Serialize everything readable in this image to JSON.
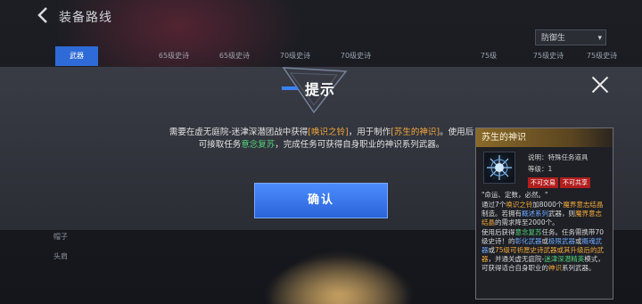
{
  "header": {
    "title": "装备路线"
  },
  "filter": {
    "selected": "防御生"
  },
  "tabs": [
    {
      "label": "武器",
      "active": true
    },
    {
      "label": "65级史诗"
    },
    {
      "label": "65级史诗"
    },
    {
      "label": "70级史诗"
    },
    {
      "label": "70级史诗"
    },
    {
      "label": "75级"
    },
    {
      "label": "75级史诗"
    },
    {
      "label": "75级史诗"
    }
  ],
  "bg_list": [
    "帽子",
    "头肩"
  ],
  "dialog": {
    "title": "提示",
    "message_parts": {
      "p1": "需要在虚无庭院-迷津深潜团战中获得",
      "item1": "[唤识之铃]",
      "p2": "，用于制作",
      "item2": "[苏生的神识]",
      "p3": "。使用后可接取任务",
      "quest": "意念复苏",
      "p4": "，完成任务可获得自身职业的神识系列武器。"
    },
    "confirm_label": "确认"
  },
  "tooltip": {
    "name": "苏生的神识",
    "desc_label": "说明：特殊任务道具",
    "level_label": "等级：1",
    "badge_untradeable": "不可交易",
    "badge_unshareable": "不可共享",
    "quote": "\"命运、定数，必然。\"",
    "body": {
      "l1a": "通过7个",
      "l1b": "唤识之铃",
      "l1c": "加8000个",
      "l1d": "魔界意志结晶",
      "l2a": "制造。若拥有",
      "l2b": "概述系列",
      "l2c": "武器，则",
      "l2d": "魔界意志结晶",
      "l2e": "的需求降至2000个。",
      "l3a": "使用后获得",
      "l3b": "意念复苏",
      "l3c": "任务。任务需携带70级史诗！的",
      "l3d": "彰化武器",
      "l3e": "或",
      "l3f": "极限武器",
      "l3g": "或",
      "l3h": "概魂武器",
      "l3i": "或",
      "l3j": "75级可祈愿史诗武器或其升级后的武器",
      "l3k": "，并通关虚无庭院-",
      "l3l": "迷津深潜精英",
      "l3m": "模式，可获得适合自身职业的",
      "l3n": "神识",
      "l3o": "系列武器。"
    }
  },
  "colors": {
    "accent_blue": "#2f6bd8",
    "highlight_orange": "#f2a93b",
    "highlight_green": "#55d07a",
    "badge_red": "#b21e1e"
  },
  "icons": [
    "back-icon",
    "close-icon",
    "triangle-deco-icon",
    "crystal-star-icon"
  ]
}
